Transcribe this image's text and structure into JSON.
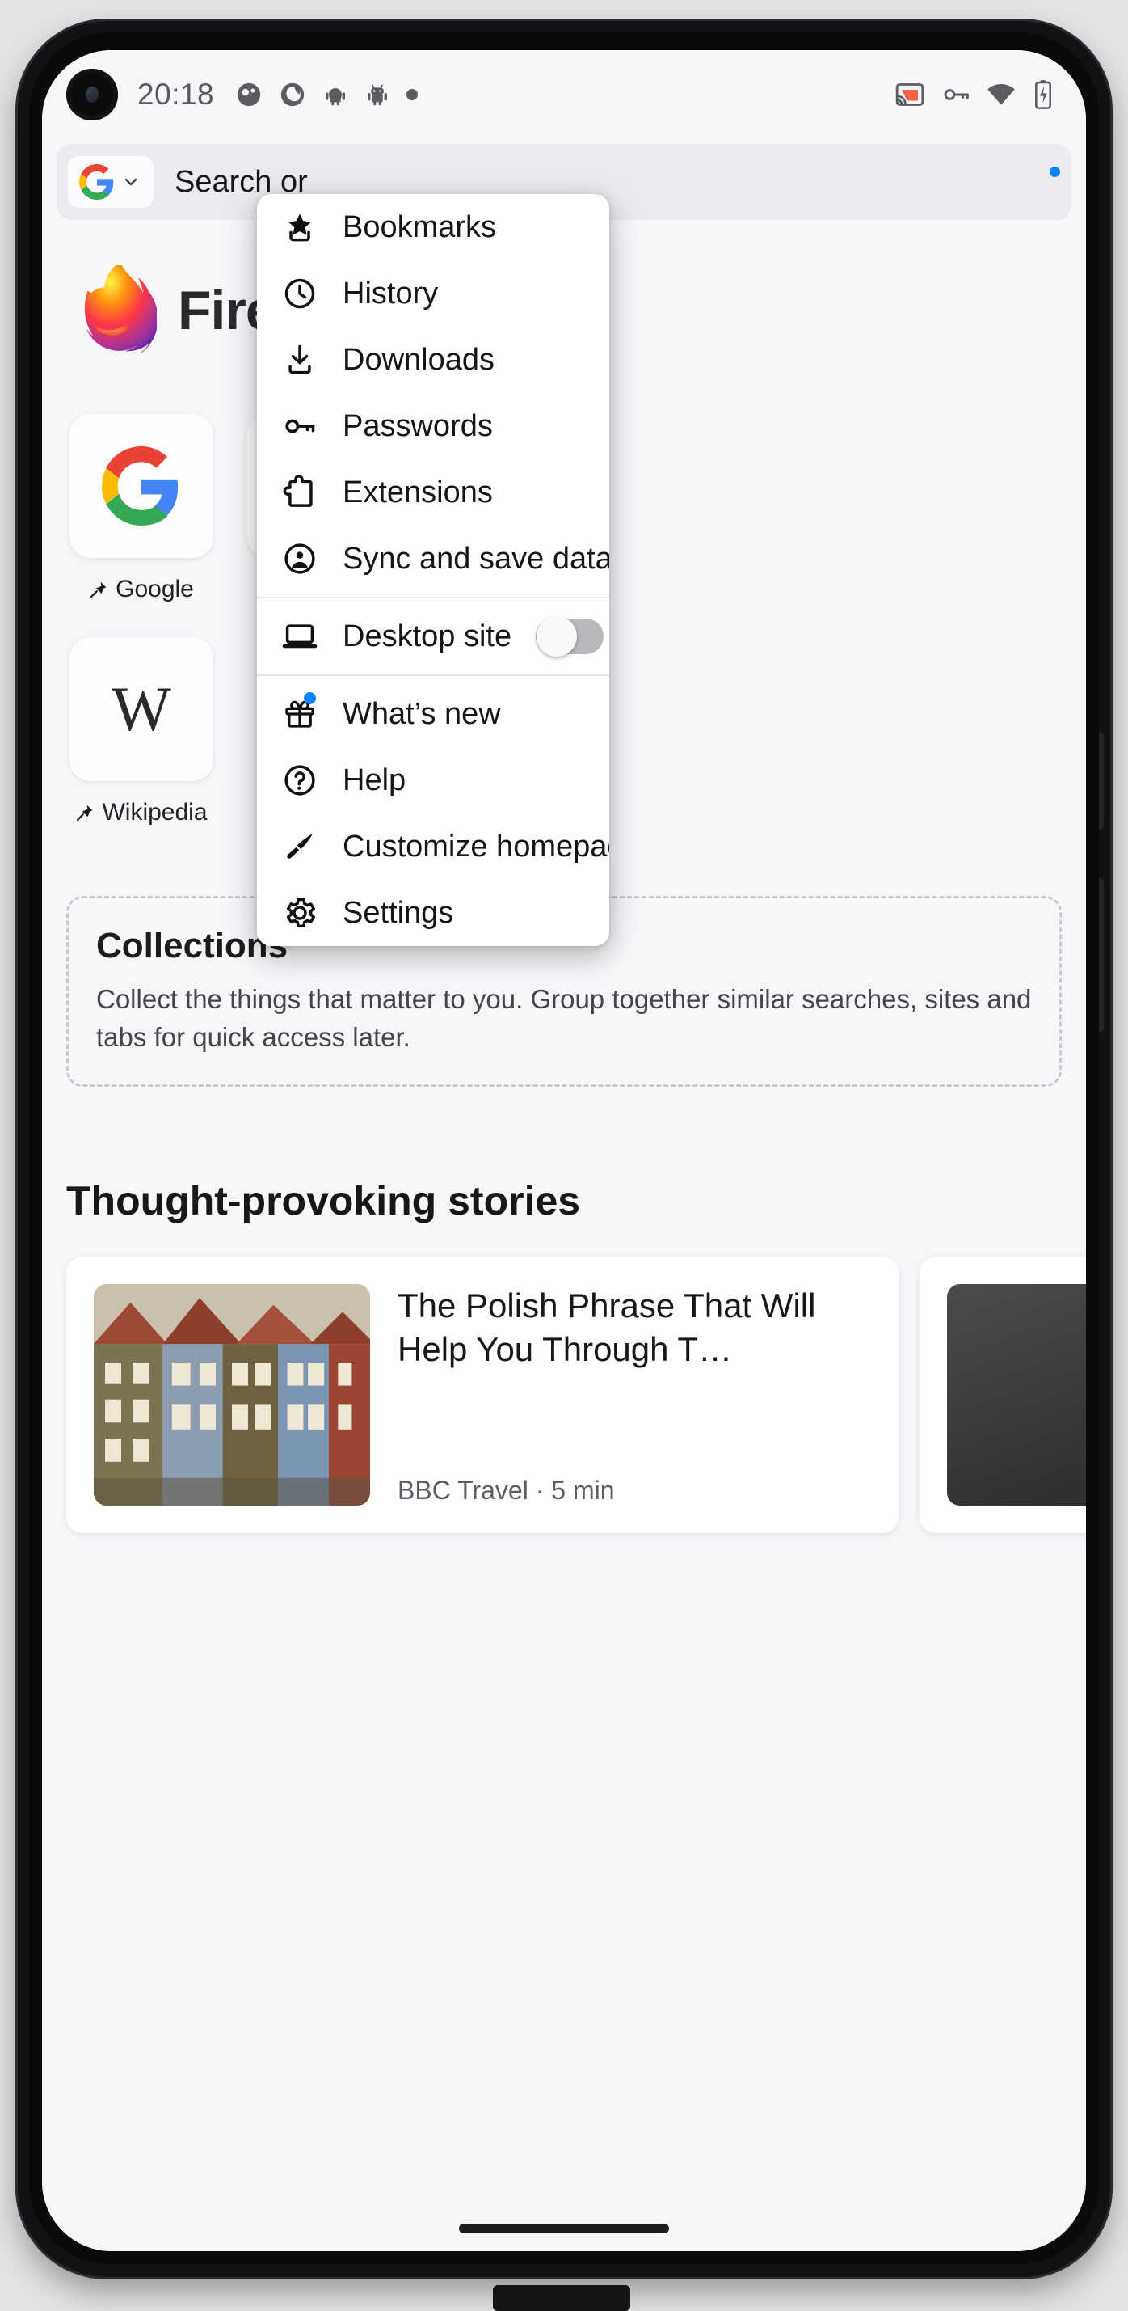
{
  "statusbar": {
    "time": "20:18",
    "left_icons": [
      "app-notification-icon",
      "sync-notification-icon",
      "android-icon",
      "android-icon-2",
      "overflow-dot-icon"
    ],
    "right_icons": [
      "cast-icon",
      "vpn-key-icon",
      "wifi-icon",
      "battery-icon"
    ],
    "cast_color": "#f2623f"
  },
  "toolbar": {
    "engine": "google",
    "engine_label": "Google",
    "url_text": "Search or",
    "url_placeholder": "Search or enter address"
  },
  "home": {
    "wordmark": "Firefox",
    "shortcuts": [
      {
        "label": "Google",
        "icon": "google-logo-icon",
        "pinned": true
      },
      {
        "label": "Wikipedia",
        "icon": "wikipedia-w-icon",
        "pinned": true
      }
    ],
    "collections": {
      "title": "Collections",
      "body": "Collect the things that matter to you. Group together similar searches, sites and tabs for quick access later."
    },
    "stories": {
      "heading": "Thought-provoking stories",
      "items": [
        {
          "title": "The Polish Phrase That Will Help You Through T…",
          "source": "BBC Travel",
          "read_time": "5 min",
          "meta": "BBC Travel · 5 min"
        }
      ]
    }
  },
  "menu": {
    "groups": [
      {
        "items": [
          {
            "label": "Bookmarks",
            "icon": "bookmark-star-icon"
          },
          {
            "label": "History",
            "icon": "clock-icon"
          },
          {
            "label": "Downloads",
            "icon": "download-icon"
          },
          {
            "label": "Passwords",
            "icon": "key-icon"
          },
          {
            "label": "Extensions",
            "icon": "puzzle-piece-icon"
          },
          {
            "label": "Sync and save data",
            "icon": "account-circle-icon"
          }
        ]
      },
      {
        "items": [
          {
            "label": "Desktop site",
            "icon": "laptop-icon",
            "toggle": true,
            "toggle_on": false
          }
        ]
      },
      {
        "items": [
          {
            "label": "What’s new",
            "icon": "gift-icon",
            "badge": true
          },
          {
            "label": "Help",
            "icon": "help-circle-icon"
          },
          {
            "label": "Customize homepage",
            "icon": "paintbrush-icon"
          },
          {
            "label": "Settings",
            "icon": "gear-icon"
          }
        ]
      }
    ]
  },
  "colors": {
    "accent_blue": "#0a84ff",
    "screen_bg": "#f7f7fa",
    "menu_bg": "#ffffff",
    "text_primary": "#16161a"
  }
}
